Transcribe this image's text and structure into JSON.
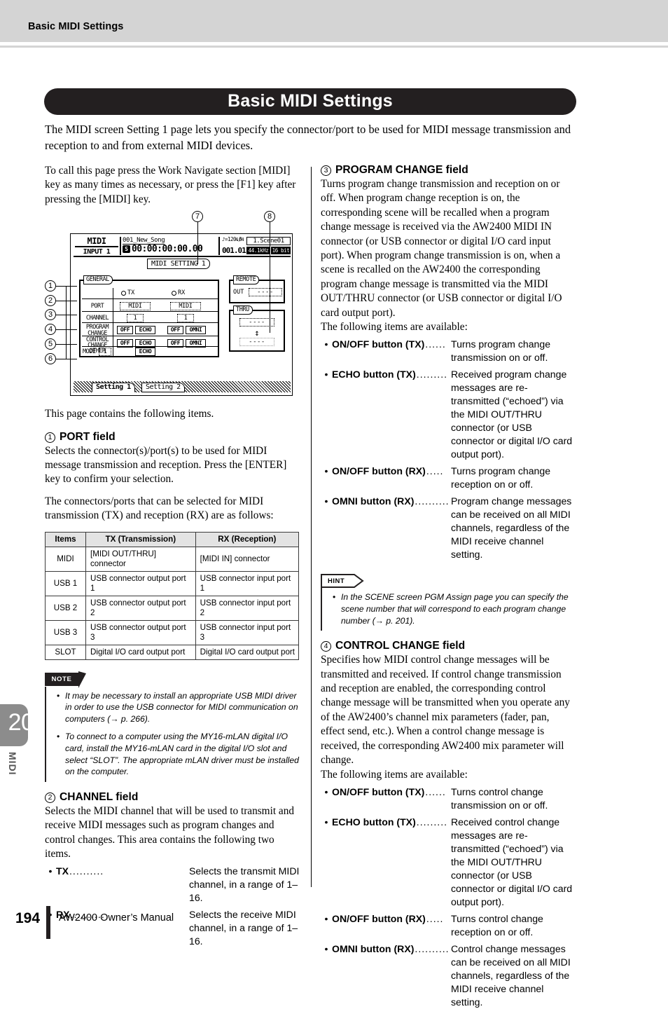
{
  "running_header": {
    "title": "Basic MIDI Settings"
  },
  "chapter_tab": {
    "number": "20",
    "label": "MIDI"
  },
  "banner": {
    "title": "Basic MIDI Settings"
  },
  "lead": "The MIDI screen Setting 1 page lets you specify the connector/port to be used for MIDI message transmission and reception to and from external MIDI devices.",
  "left_column": {
    "intro": "To call this page press the Work Navigate section [MIDI] key as many times as necessary, or press the [F1] key after pressing the [MIDI] key.",
    "after_figure": "This page contains the following items.",
    "port_section": {
      "num": "1",
      "title": "PORT field",
      "para1": "Selects the connector(s)/port(s) to be used for MIDI message transmission and reception. Press the [ENTER] key to confirm your selection.",
      "para2": "The connectors/ports that can be selected for MIDI transmission (TX) and reception (RX) are as follows:"
    },
    "port_table": {
      "headers": [
        "Items",
        "TX (Transmission)",
        "RX (Reception)"
      ],
      "rows": [
        [
          "MIDI",
          "[MIDI OUT/THRU] connector",
          "[MIDI IN] connector"
        ],
        [
          "USB 1",
          "USB connector output port 1",
          "USB connector input port 1"
        ],
        [
          "USB 2",
          "USB connector output port 2",
          "USB connector input port 2"
        ],
        [
          "USB 3",
          "USB connector output port 3",
          "USB connector input port 3"
        ],
        [
          "SLOT",
          "Digital I/O card output port",
          "Digital I/O card output port"
        ]
      ]
    },
    "note": {
      "tag": "NOTE",
      "items": [
        "It may be necessary to install an appropriate USB MIDI driver in order to use the USB connector for MIDI communication on computers (→ p. 266).",
        "To connect to a computer using the MY16-mLAN digital I/O card, install the MY16-mLAN card in the digital I/O slot and select “SLOT”. The appropriate mLAN driver must be installed on the computer."
      ]
    },
    "channel_section": {
      "num": "2",
      "title": "CHANNEL field",
      "para1": "Selects the MIDI channel that will be used to transmit and receive MIDI messages such as program changes and control changes. This area contains the following two items.",
      "bullets": [
        {
          "term": "TX",
          "dots": "..........",
          "def": "Selects the transmit MIDI channel, in a range of 1–16."
        },
        {
          "term": "RX",
          "dots": "..........",
          "def": "Selects the receive MIDI channel, in a range of 1–16."
        }
      ]
    }
  },
  "right_column": {
    "program_change_section": {
      "num": "3",
      "title": "PROGRAM CHANGE field",
      "para1": "Turns program change transmission and reception on or off. When program change reception is on, the corresponding scene will be recalled when a program change message is received via the AW2400 MIDI IN connector (or USB connector or digital I/O card input port). When program change transmission is on, when a scene is recalled on the AW2400 the corresponding program change message is transmitted via the MIDI OUT/THRU connector (or USB connector or digital I/O card output port).",
      "para2": "The following items are available:",
      "bullets": [
        {
          "term": "ON/OFF button (TX)",
          "dots": "......",
          "def": "Turns program change transmission on or off."
        },
        {
          "term": "ECHO button (TX)",
          "dots": ".........",
          "def": "Received program change messages are re-transmitted (“echoed”) via the MIDI OUT/THRU connector (or USB connector or digital I/O card output port)."
        },
        {
          "term": "ON/OFF button (RX)",
          "dots": ".....",
          "def": "Turns program change reception on or off."
        },
        {
          "term": "OMNI button (RX)",
          "dots": "..........",
          "def": "Program change messages can be received on all MIDI channels, regardless of the MIDI receive channel setting."
        }
      ]
    },
    "hint": {
      "tag": "HINT",
      "items": [
        "In the SCENE screen PGM Assign page you can specify the scene number that will correspond to each program change number (→ p. 201)."
      ]
    },
    "control_change_section": {
      "num": "4",
      "title": "CONTROL CHANGE field",
      "para1": "Specifies how MIDI control change messages will be transmitted and received. If control change transmission and reception are enabled, the corresponding control change message will be transmitted when you operate any of the AW2400’s channel mix parameters (fader, pan, effect send, etc.). When a control change message is received, the corresponding AW2400 mix parameter will change.",
      "para2": "The following items are available:",
      "bullets": [
        {
          "term": "ON/OFF button (TX)",
          "dots": "......",
          "def": "Turns control change transmission on or off."
        },
        {
          "term": "ECHO button (TX)",
          "dots": ".........",
          "def": "Received control change messages are re-transmitted (“echoed”) via the MIDI OUT/THRU connector (or USB connector or digital I/O card output port)."
        },
        {
          "term": "ON/OFF button (RX)",
          "dots": ".....",
          "def": "Turns control change reception on or off."
        },
        {
          "term": "OMNI button (RX)",
          "dots": "..........",
          "def": "Control change messages can be received on all MIDI channels, regardless of the MIDI receive channel setting."
        }
      ]
    }
  },
  "figure": {
    "callouts": [
      "1",
      "2",
      "3",
      "4",
      "5",
      "6",
      "7",
      "8"
    ],
    "lcd": {
      "mode_line1": "MIDI",
      "mode_line2": "INPUT 1",
      "song_name": "001_New_Song",
      "timecode_badge": "S",
      "timecode": "00:00:00:00.00",
      "tempo": "♪=120.0",
      "meter": "4/4",
      "bar": "001.01",
      "scene": "1.Scene01",
      "sample_rate": "44.1kHz",
      "bit_depth": "16 bit",
      "page_title": "MIDI SETTING 1",
      "general_label": "GENERAL",
      "col_tx": "TX",
      "col_rx": "RX",
      "rows": [
        {
          "label": "PORT",
          "tx": "MIDI",
          "rx": "MIDI"
        },
        {
          "label": "CHANNEL",
          "tx": "1",
          "rx": "1"
        },
        {
          "label_a": "PROGRAM",
          "label_b": "CHANGE",
          "buttons": [
            "OFF",
            "ECHO",
            "OFF",
            "OMNI"
          ]
        },
        {
          "label_a": "CONTROL",
          "label_b": "CHANGE",
          "buttons": [
            "OFF",
            "ECHO",
            "OFF",
            "OMNI"
          ]
        },
        {
          "mode_label": "MODE",
          "mode_value": "1"
        },
        {
          "label": "OTHER",
          "button": "ECHO"
        }
      ],
      "remote_label": "REMOTE",
      "remote_out_label": "OUT",
      "remote_out_value": "----",
      "thru_label": "THRU",
      "thru_top_value": "----",
      "thru_bottom_value": "----",
      "thru_arrow": "↕",
      "tabs": [
        {
          "label": "Setting 1",
          "active": true
        },
        {
          "label": "Setting 2",
          "active": false
        }
      ]
    }
  },
  "footer": {
    "page_number": "194",
    "text": "AW2400  Owner’s Manual"
  }
}
